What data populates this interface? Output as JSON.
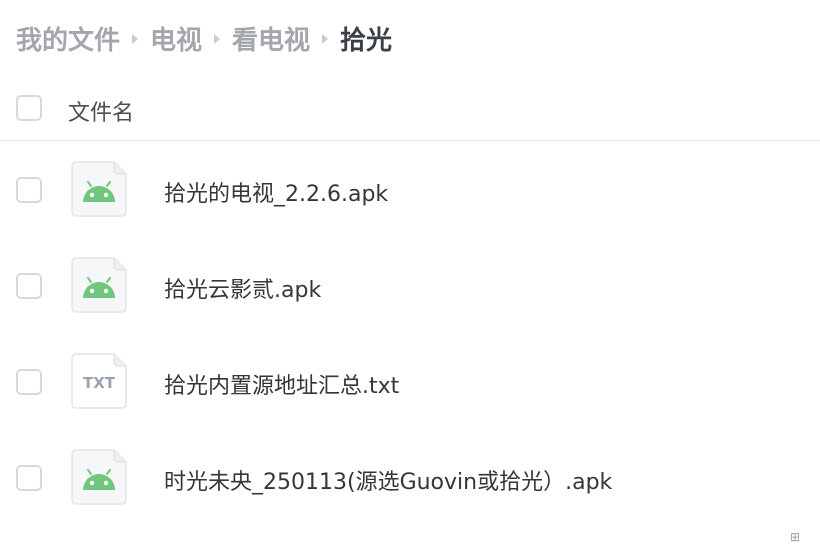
{
  "breadcrumb": {
    "items": [
      "我的文件",
      "电视",
      "看电视"
    ],
    "current": "拾光"
  },
  "list": {
    "header": "文件名",
    "files": [
      {
        "name": "拾光的电视_2.2.6.apk",
        "type": "apk",
        "icon": "android-icon"
      },
      {
        "name": "拾光云影贰.apk",
        "type": "apk",
        "icon": "android-icon"
      },
      {
        "name": "拾光内置源地址汇总.txt",
        "type": "txt",
        "icon": "txt-file-icon",
        "icon_text": "TXT"
      },
      {
        "name": "时光未央_250113(源选Guovin或拾光）.apk",
        "type": "apk",
        "icon": "android-icon"
      }
    ]
  },
  "colors": {
    "android_green": "#6fc77c",
    "txt_gray": "#9aa3b0",
    "crumb_inactive": "#a3a6ad",
    "crumb_active": "#3b3f46"
  }
}
